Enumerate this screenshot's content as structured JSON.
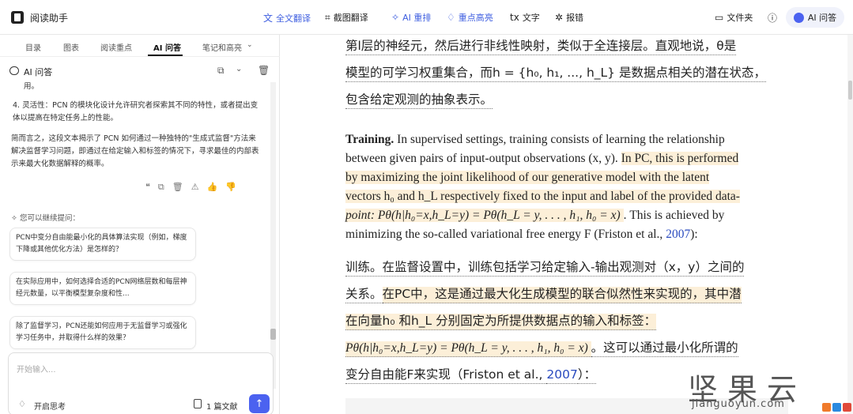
{
  "app": {
    "title": "阅读助手"
  },
  "toolbar": {
    "full_translate": "全文翻译",
    "screenshot_translate": "截图翻译",
    "ai_rearrange": "AI 重排",
    "highlight": "重点高亮",
    "text": "文字",
    "report_error": "报错",
    "folder": "文件夹",
    "ai_ask": "AI 问答"
  },
  "sidebar": {
    "tabs": [
      "目录",
      "图表",
      "阅读重点",
      "AI 问答",
      "笔记和高亮"
    ],
    "active_tab": "AI 问答",
    "panel_title": "AI 问答",
    "truncated_line": "用。",
    "item4": "4. 灵活性：PCN 的模块化设计允许研究者探索其不同的特性，或者提出变体以提高在特定任务上的性能。",
    "summary": "简而言之，这段文本揭示了 PCN 如何通过一种独特的\"生成式监督\"方法来解决监督学习问题，即通过在给定输入和标签的情况下，寻求最佳的内部表示来最大化数据解释的概率。",
    "followup_label": "您可以继续提问：",
    "suggestions": [
      "PCN中变分自由能最小化的具体算法实现（例如，梯度下降或其他优化方法）是怎样的？",
      "在实际应用中，如何选择合适的PCN网络层数和每层神经元数量，以平衡模型复杂度和性...",
      "除了监督学习，PCN还能如何应用于无监督学习或强化学习任务中，并取得什么样的效果？"
    ],
    "input_placeholder": "开始输入...",
    "think_toggle": "开启思考",
    "docs_count": "1 篇文献"
  },
  "document": {
    "cn_lines": [
      "第l层的神经元，然后进行非线性映射，类似于全连接层。直观地说，θ是",
      "模型的可学习权重集合，而h = {h₀, h₁, ..., h_L} 是数据点相关的潜在状态，",
      "包含给定观测的抽象表示。"
    ],
    "en_heading": "Training.",
    "en_lines": [
      " In supervised settings, training consists of learning the relationship",
      "between given pairs of input-output observations (x, y). ",
      "In PC, this is performed",
      "by maximizing the joint likelihood of our generative model with the latent",
      "vectors h₀  and h_L  respectively fixed to the input and label of the provided data-",
      "point: Pθ(h|h₀=x,h_L=y) = Pθ(h_L = y, . . . , h₁, h₀ = x) ",
      ". This is achieved by",
      "minimizing the so-called variational free energy F  (Friston et al., ",
      "2007",
      "):"
    ],
    "cn_train": [
      "训练。在监督设置中，训练包括学习给定输入-输出观测对（x，y）之间的",
      "关系。",
      "在PC中，这是通过最大化生成模型的联合似然性来实现的，其中潜",
      "在向量h₀ 和h_L 分别固定为所提供数据点的输入和标签：",
      "Pθ(h|h₀=x,h_L=y) = Pθ(h_L = y, . . . , h₁, h₀ = x) ",
      "。这可以通过最小化所谓的",
      "变分自由能F来实现（Friston et al., ",
      "2007",
      "）："
    ]
  },
  "watermark": {
    "cn": "坚果云",
    "en": "jianguoyun.com"
  },
  "colors": {
    "accent": "#3f5fe0",
    "highlight": "#fcefd8",
    "send_button": "#4b62f0"
  }
}
